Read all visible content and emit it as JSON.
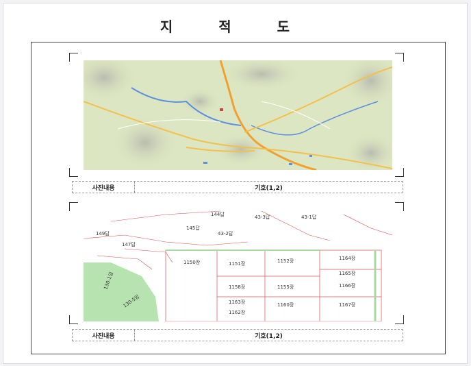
{
  "document": {
    "title": "지 적 도"
  },
  "sections": [
    {
      "caption_label": "사진내용",
      "caption_value": "기호(1,2)"
    },
    {
      "caption_label": "사진내용",
      "caption_value": "기호(1,2)"
    }
  ],
  "parcel_labels": [
    "144답",
    "43-3답",
    "43-1답",
    "145답",
    "43-2답",
    "149답",
    "147답",
    "1150장",
    "1151장",
    "1152장",
    "1164장",
    "1165장",
    "1158장",
    "1155장",
    "1166장",
    "1163장",
    "1160장",
    "1162장",
    "1167장",
    "130-1임",
    "130-5임"
  ],
  "colors": {
    "road_orange": "#f0a030",
    "terrain": "#dde6c2",
    "water": "#5b8fe0",
    "forest_green": "#b7e3b0",
    "parcel_red": "#d85050"
  }
}
